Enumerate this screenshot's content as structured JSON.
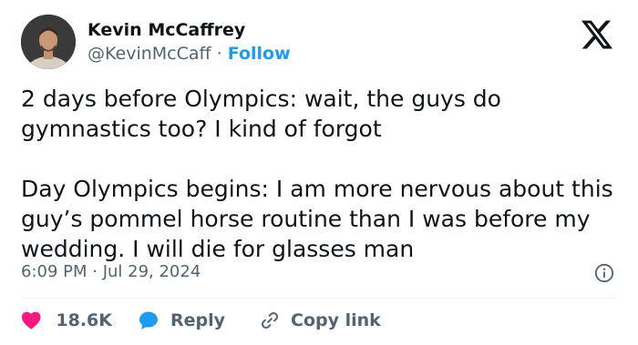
{
  "author": {
    "name": "Kevin McCaffrey",
    "handle": "@KevinMcCaff",
    "separator": "·",
    "follow_label": "Follow"
  },
  "tweet": {
    "paragraphs": [
      "2 days before Olympics: wait, the guys do gymnastics too? I kind of forgot",
      "Day Olympics begins: I am more nervous about this guy’s pommel horse routine than I was before my wedding. I will die for glasses man"
    ],
    "timestamp": "6:09 PM · Jul 29, 2024"
  },
  "actions": {
    "like_count": "18.6K",
    "reply_label": "Reply",
    "copy_link_label": "Copy link"
  },
  "icons": {
    "brand": "x-logo-icon",
    "info": "info-icon",
    "like": "heart-icon",
    "reply": "reply-bubble-icon",
    "copy_link": "link-icon"
  },
  "colors": {
    "accent": "#1d9bf0",
    "heart": "#f91880",
    "text": "#0f1419",
    "muted": "#536471"
  }
}
